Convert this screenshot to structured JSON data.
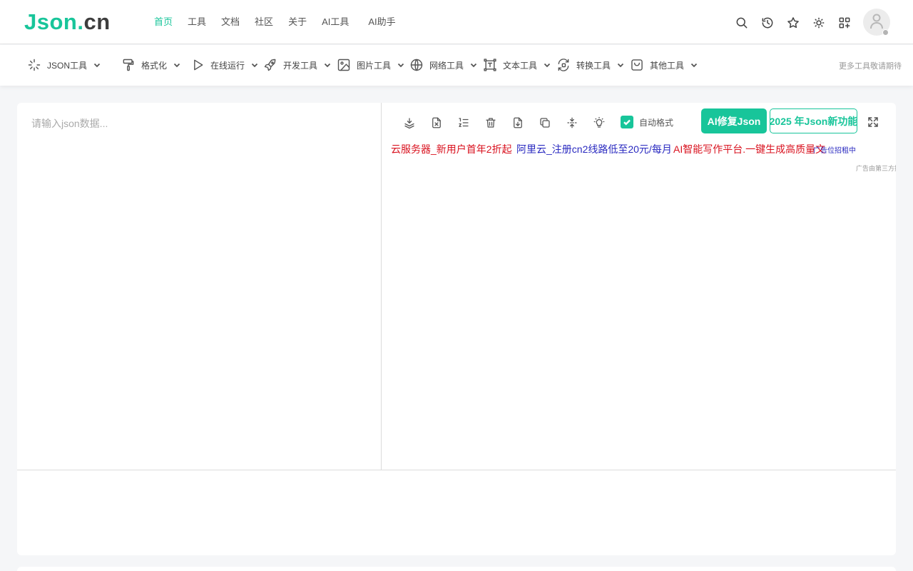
{
  "header": {
    "logo_main": "Json",
    "logo_dot": ".",
    "logo_tld": "cn",
    "nav": [
      "首页",
      "工具",
      "文档",
      "社区",
      "关于",
      "AI工具",
      "AI助手"
    ]
  },
  "header_icons": [
    "search-icon",
    "history-icon",
    "star-icon",
    "sun-icon",
    "apps-icon",
    "avatar-icon"
  ],
  "toolbar": {
    "items": [
      {
        "icon": "sparkle-icon",
        "label": "JSON工具"
      },
      {
        "icon": "paint-roller-icon",
        "label": "格式化"
      },
      {
        "icon": "play-icon",
        "label": "在线运行"
      },
      {
        "icon": "rocket-icon",
        "label": "开发工具"
      },
      {
        "icon": "image-icon",
        "label": "图片工具"
      },
      {
        "icon": "globe-icon",
        "label": "网络工具"
      },
      {
        "icon": "frame-icon",
        "label": "文本工具"
      },
      {
        "icon": "convert-icon",
        "label": "转换工具"
      },
      {
        "icon": "bag-icon",
        "label": "其他工具"
      }
    ],
    "hint": "更多工具敬请期待"
  },
  "editor": {
    "placeholder": "请输入json数据..."
  },
  "result_toolbar": {
    "icons": [
      "layers-icon",
      "clear-file-icon",
      "line-number-icon",
      "trash-icon",
      "download-icon",
      "copy-icon",
      "compress-icon",
      "bulb-icon"
    ],
    "checkbox_label": "自动格式",
    "ai_button": "AI修复Json",
    "year_button": "2025 年Json新功能"
  },
  "ads": {
    "ad1": "云服务器_新用户首年2折起",
    "ad2": "阿里云_注册cn2线路低至20元/每月",
    "ad3": "AI智能写作平台.一键生成高质量文",
    "ad4": "广告位招租中",
    "note": "广告由第三方提供"
  },
  "colors": {
    "brand": "#18c59a",
    "ad_red": "#d9121f",
    "ad_blue": "#2a2ac0"
  }
}
